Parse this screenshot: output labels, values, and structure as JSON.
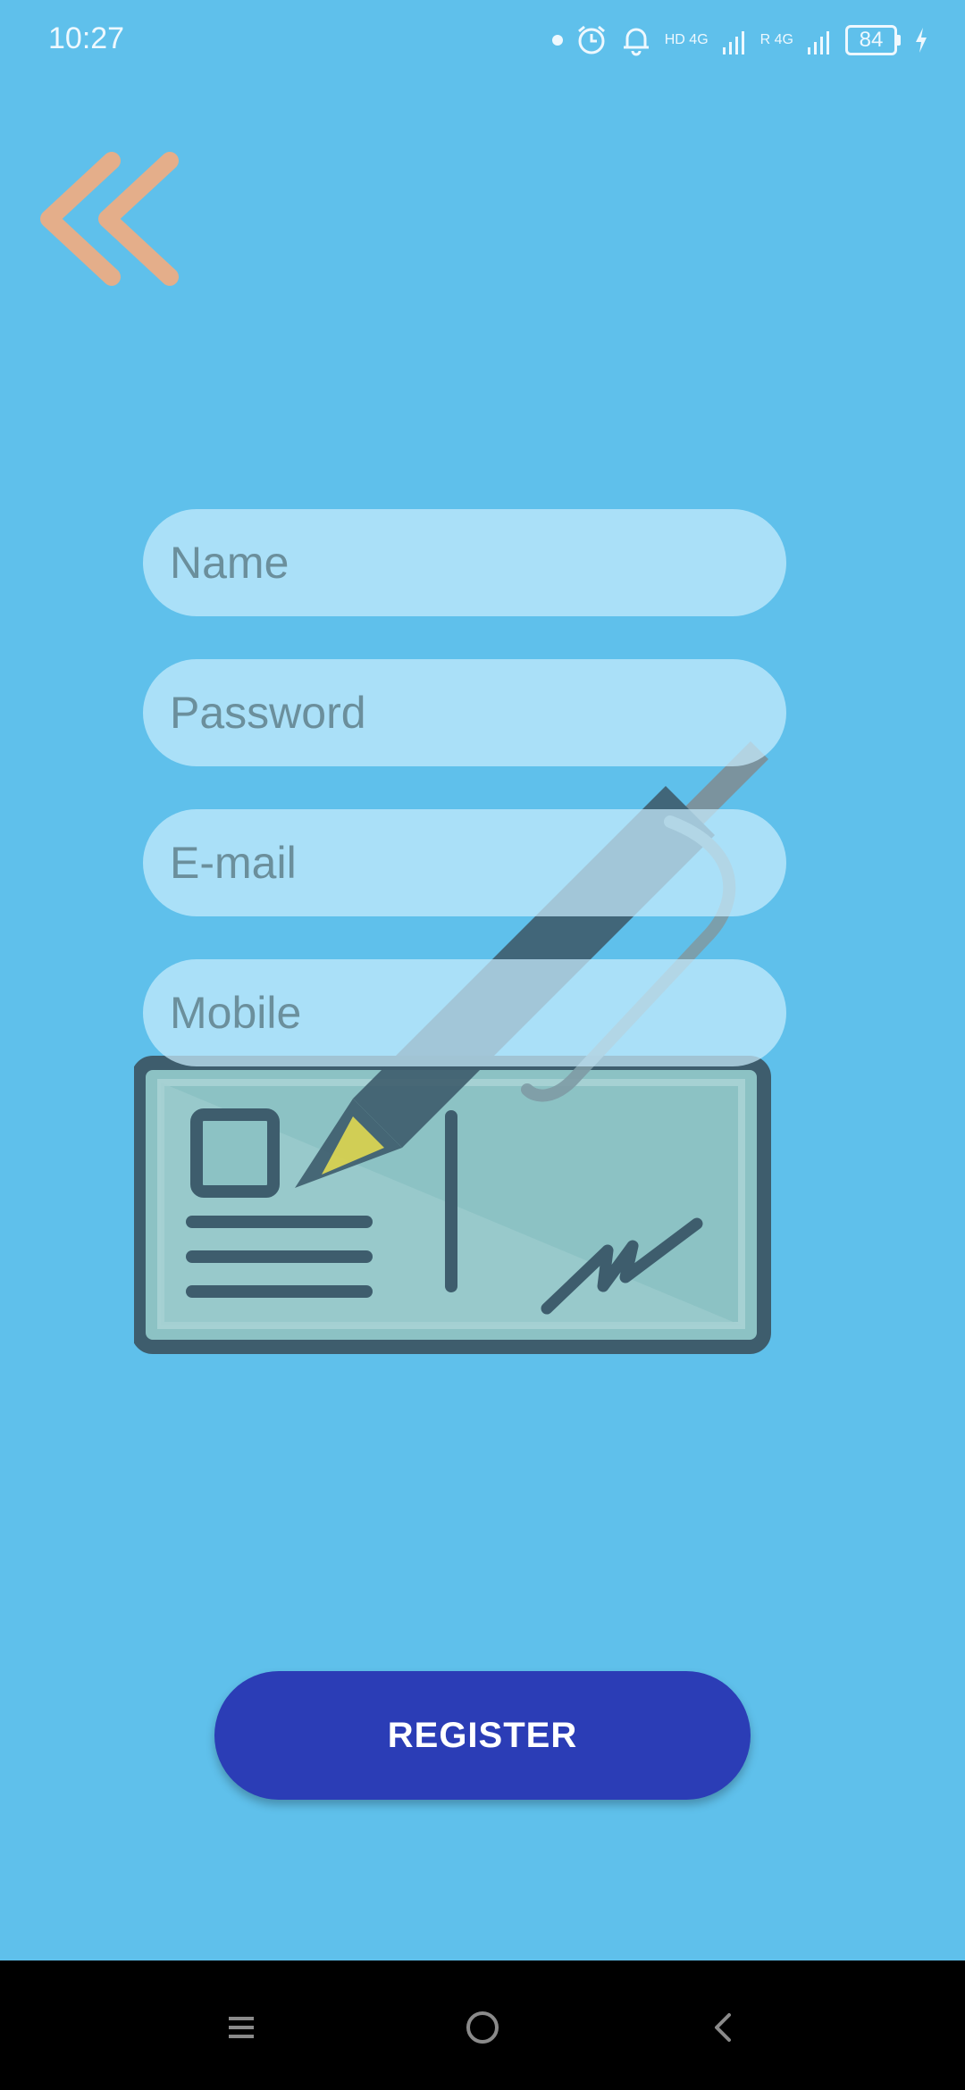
{
  "status_bar": {
    "time": "10:27",
    "network_1": "4G",
    "network_1_sub": "HD",
    "network_2": "4G",
    "roaming": "R",
    "battery": "84"
  },
  "icons": {
    "back": "double-chevron-left-icon",
    "illustration": "signed-document-with-pen-icon",
    "nav_menu": "menu-icon",
    "nav_home": "home-circle-icon",
    "nav_back": "chevron-left-icon"
  },
  "form": {
    "name_placeholder": "Name",
    "password_placeholder": "Password",
    "email_placeholder": "E-mail",
    "mobile_placeholder": "Mobile"
  },
  "register_label": "REGISTER",
  "colors": {
    "background": "#5fc0eb",
    "button": "#2b3db6",
    "back_icon": "#e4ae8a"
  }
}
